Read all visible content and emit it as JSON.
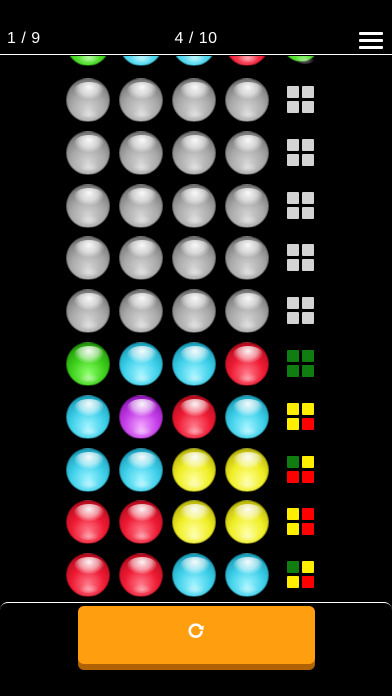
{
  "header": {
    "level_counter": "1 / 9",
    "attempt_counter": "4 / 10",
    "menu_icon": "hamburger-menu-icon"
  },
  "board": {
    "partial_top_row": {
      "balls": [
        "green",
        "cyan",
        "cyan",
        "red"
      ],
      "indicator": "green"
    },
    "rows": [
      {
        "balls": [
          "gray",
          "gray",
          "gray",
          "gray"
        ],
        "pegs": [
          "blank",
          "blank",
          "blank",
          "blank"
        ]
      },
      {
        "balls": [
          "gray",
          "gray",
          "gray",
          "gray"
        ],
        "pegs": [
          "blank",
          "blank",
          "blank",
          "blank"
        ]
      },
      {
        "balls": [
          "gray",
          "gray",
          "gray",
          "gray"
        ],
        "pegs": [
          "blank",
          "blank",
          "blank",
          "blank"
        ]
      },
      {
        "balls": [
          "gray",
          "gray",
          "gray",
          "gray"
        ],
        "pegs": [
          "blank",
          "blank",
          "blank",
          "blank"
        ]
      },
      {
        "balls": [
          "gray",
          "gray",
          "gray",
          "gray"
        ],
        "pegs": [
          "blank",
          "blank",
          "blank",
          "blank"
        ]
      },
      {
        "balls": [
          "green",
          "cyan",
          "cyan",
          "red"
        ],
        "pegs": [
          "green",
          "green",
          "green",
          "green"
        ]
      },
      {
        "balls": [
          "cyan",
          "purple",
          "red",
          "cyan"
        ],
        "pegs": [
          "yellow",
          "yellow",
          "yellow",
          "red"
        ]
      },
      {
        "balls": [
          "cyan",
          "cyan",
          "yellow",
          "yellow"
        ],
        "pegs": [
          "green",
          "yellow",
          "red",
          "red"
        ]
      },
      {
        "balls": [
          "red",
          "red",
          "yellow",
          "yellow"
        ],
        "pegs": [
          "yellow",
          "red",
          "yellow",
          "red"
        ]
      },
      {
        "balls": [
          "red",
          "red",
          "cyan",
          "cyan"
        ],
        "pegs": [
          "green",
          "yellow",
          "yellow",
          "red"
        ]
      }
    ]
  },
  "actions": {
    "retry_icon": "refresh-icon"
  },
  "colors": {
    "button_orange": "#ff9e0f",
    "button_shadow": "#b06205",
    "peg_green": "#0f7d0f",
    "peg_yellow": "#ffee00",
    "peg_red": "#ff0000",
    "peg_blank": "#d3d3d3"
  }
}
